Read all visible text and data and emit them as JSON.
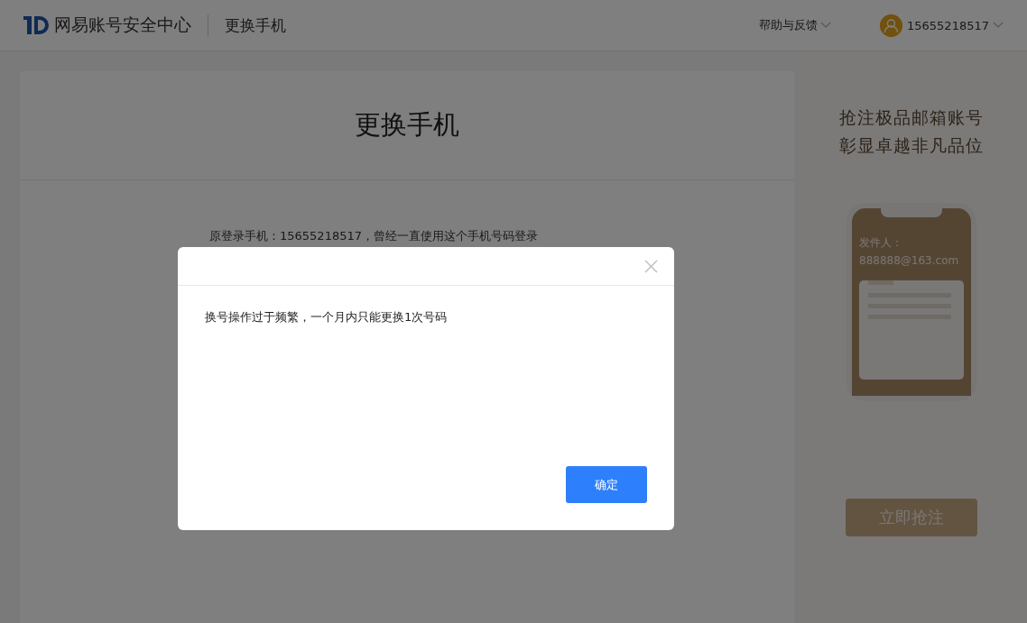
{
  "header": {
    "brand": "网易账号安全中心",
    "page_title": "更换手机",
    "help": "帮助与反馈",
    "account": "15655218517"
  },
  "card": {
    "title": "更换手机",
    "info": "原登录手机：15655218517，曾经一直使用这个手机号码登录"
  },
  "ad": {
    "headline": [
      "抢注极品邮箱账号",
      "彰显卓越非凡品位"
    ],
    "sender_label": "发件人：",
    "sender_email": "888888@163.com",
    "button": "立即抢注"
  },
  "dialog": {
    "message": "换号操作过于频繁，一个月内只能更换1次号码",
    "confirm": "确定"
  }
}
